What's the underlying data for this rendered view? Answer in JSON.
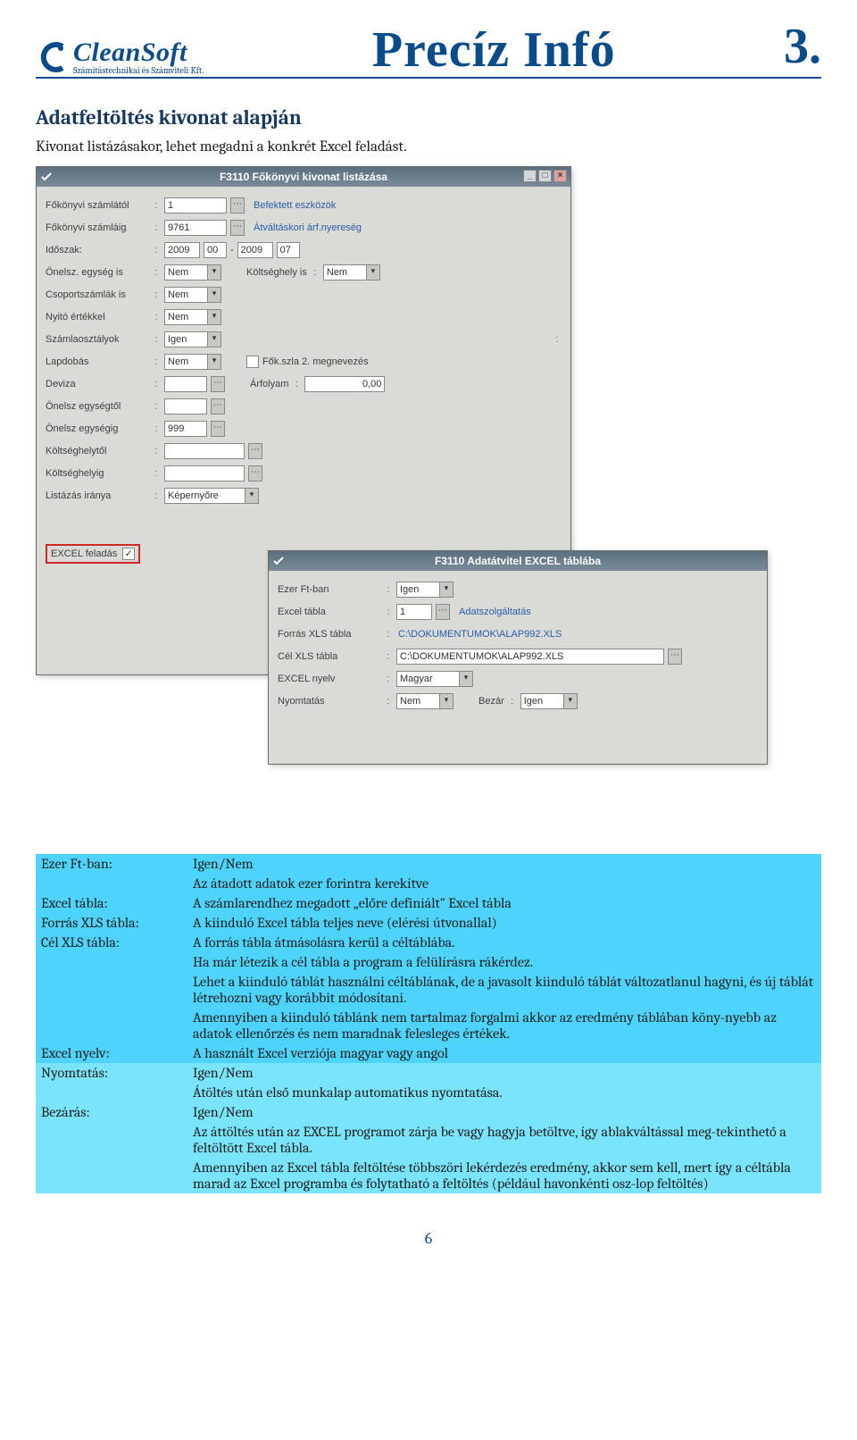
{
  "header": {
    "logo_main": "CleanSoft",
    "logo_sub": "Számítástechnikai és Számviteli Kft.",
    "title": "Precíz Infó",
    "page_number_top": "3."
  },
  "section": {
    "heading": "Adatfeltöltés kivonat alapján",
    "intro": "Kivonat listázásakor, lehet megadni a konkrét Excel feladást."
  },
  "win1": {
    "title": "F3110 Főkönyvi kivonat listázása",
    "rows": {
      "szamlatol_label": "Főkönyvi számlától",
      "szamlatol_value": "1",
      "szamlatol_hint": "Befektett eszközök",
      "szamlaig_label": "Főkönyvi számláig",
      "szamlaig_value": "9761",
      "szamlaig_hint": "Átváltáskori árf.nyereség",
      "idoszak_label": "Időszak:",
      "idoszak_y1": "2009",
      "idoszak_m1": "00",
      "idoszak_y2": "2009",
      "idoszak_m2": "07",
      "onelsz_label": "Önelsz. egység is",
      "onelsz_value": "Nem",
      "ktghely_label": "Költséghely is",
      "ktghely_value": "Nem",
      "csoport_label": "Csoportszámlák is",
      "csoport_value": "Nem",
      "nyito_label": "Nyitó értékkel",
      "nyito_value": "Nem",
      "szamlao_label": "Számlaosztályok",
      "szamlao_value": "Igen",
      "lapdobas_label": "Lapdobás",
      "lapdobas_value": "Nem",
      "fok2_label": "Fők.szla 2. megnevezés",
      "deviza_label": "Deviza",
      "arfolyam_label": "Árfolyam",
      "arfolyam_value": "0,00",
      "onelsz_tol_label": "Önelsz egységtől",
      "onelsz_ig_label": "Önelsz egységig",
      "onelsz_ig_value": "999",
      "ktgh_tol_label": "Költséghelytől",
      "ktgh_ig_label": "Költséghelyig",
      "listazas_label": "Listázás iránya",
      "listazas_value": "Képernyőre",
      "excel_feladas_label": "EXCEL feladás"
    }
  },
  "win2": {
    "title": "F3110 Adatátvitel  EXCEL táblába",
    "rows": {
      "ezer_label": "Ezer Ft-ban",
      "ezer_value": "Igen",
      "etabla_label": "Excel tábla",
      "etabla_value": "1",
      "etabla_hint": "Adatszolgáltatás",
      "forras_label": "Forrás XLS tábla",
      "forras_value": "C:\\DOKUMENTUMOK\\ALAP992.XLS",
      "cel_label": "Cél XLS tábla",
      "cel_value": "C:\\DOKUMENTUMOK\\ALAP992.XLS",
      "nyelv_label": "EXCEL nyelv",
      "nyelv_value": "Magyar",
      "nyomt_label": "Nyomtatás",
      "nyomt_value": "Nem",
      "bezar_label": "Bezár",
      "bezar_value": "Igen"
    }
  },
  "desc": {
    "rows": [
      [
        "Ezer Ft-ban:",
        "Igen/Nem"
      ],
      [
        "",
        "Az átadott adatok ezer forintra kerekítve"
      ],
      [
        "Excel tábla:",
        "A számlarendhez megadott „előre definiált” Excel tábla"
      ],
      [
        "Forrás XLS tábla:",
        "A kiinduló Excel tábla teljes neve (elérési útvonallal)"
      ],
      [
        "Cél XLS tábla:",
        "A forrás tábla átmásolásra kerül a céltáblába."
      ],
      [
        "",
        "Ha már létezik a cél tábla a program a felülírásra rákérdez."
      ],
      [
        "",
        "Lehet a kiinduló táblát használni céltáblának, de a javasolt kiinduló táblát változatlanul hagyni, és új táblát létrehozni vagy korábbit módosítani."
      ],
      [
        "",
        "Amennyiben a kiinduló táblánk nem tartalmaz forgalmi akkor az eredmény táblában köny-nyebb az adatok ellenőrzés és nem maradnak felesleges értékek."
      ],
      [
        "Excel nyelv:",
        "A használt Excel verziója magyar vagy angol"
      ],
      [
        "Nyomtatás:",
        "Igen/Nem"
      ],
      [
        "",
        "Átöltés után első munkalap automatikus nyomtatása."
      ],
      [
        "Bezárás:",
        "Igen/Nem"
      ],
      [
        "",
        "Az áttöltés után az EXCEL programot zárja be vagy hagyja betöltve, így ablakváltással meg-tekinthető a feltöltött Excel tábla."
      ],
      [
        "",
        "Amennyiben az Excel tábla feltöltése többszöri lekérdezés eredmény, akkor sem kell, mert így a céltábla marad az Excel programba és folytatható a feltöltés (például havonkénti osz-lop feltöltés)"
      ]
    ],
    "group_split": 9
  },
  "footer_page": "6"
}
